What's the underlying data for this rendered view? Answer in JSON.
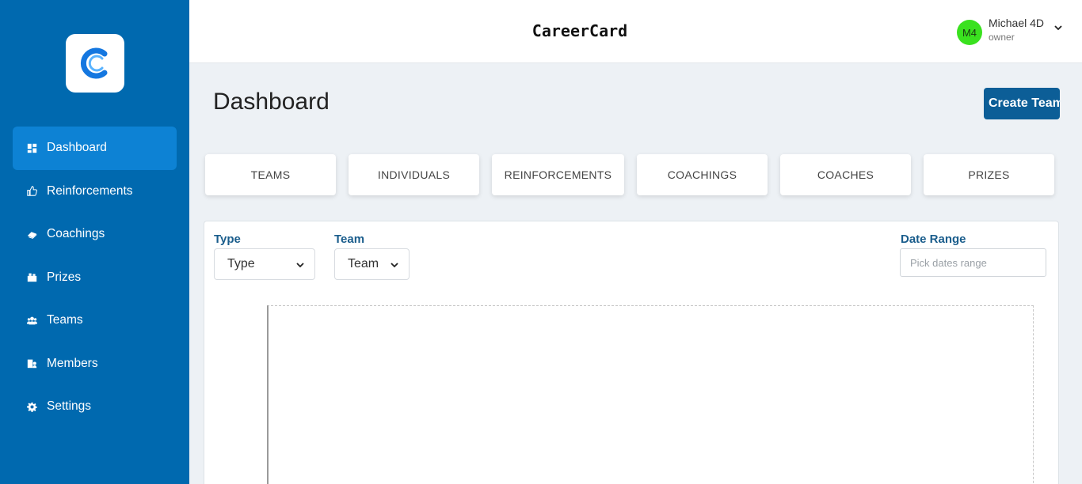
{
  "app": {
    "title": "CareerCard"
  },
  "user": {
    "initials": "M4",
    "name": "Michael 4D",
    "role": "owner"
  },
  "sidebar": {
    "items": [
      {
        "label": "Dashboard",
        "icon": "dashboard-icon",
        "active": true
      },
      {
        "label": "Reinforcements",
        "icon": "thumbs-up-icon"
      },
      {
        "label": "Coachings",
        "icon": "coaching-icon"
      },
      {
        "label": "Prizes",
        "icon": "prize-icon"
      },
      {
        "label": "Teams",
        "icon": "users-icon"
      },
      {
        "label": "Members",
        "icon": "members-icon"
      },
      {
        "label": "Settings",
        "icon": "gear-icon"
      }
    ]
  },
  "page": {
    "title": "Dashboard",
    "create_button": "Create Team"
  },
  "tabs": [
    "TEAMS",
    "INDIVIDUALS",
    "REINFORCEMENTS",
    "COACHINGS",
    "COACHES",
    "PRIZES"
  ],
  "filters": {
    "type": {
      "label": "Type",
      "value": "Type"
    },
    "team": {
      "label": "Team",
      "value": "Team"
    },
    "date_range": {
      "label": "Date Range",
      "placeholder": "Pick dates range"
    }
  },
  "colors": {
    "sidebar": "#0069af",
    "active_nav": "#0d82d4",
    "primary_button": "#0c5e97",
    "avatar": "#3ae11f",
    "label": "#1a5d8c"
  }
}
